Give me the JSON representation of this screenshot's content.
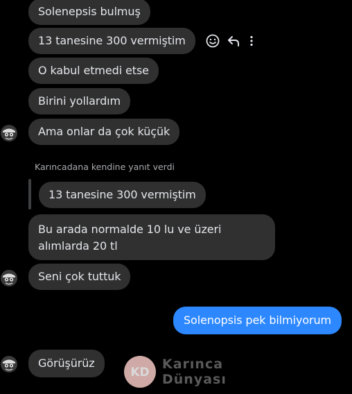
{
  "thread": {
    "messages": [
      {
        "text": "Solenepsis bulmuş"
      },
      {
        "text": "13 tanesine 300 vermiştim"
      },
      {
        "text": "O kabul etmedi etse"
      },
      {
        "text": "Birini yollardım"
      },
      {
        "text": "Ama onlar da çok küçük"
      },
      {
        "text": "Bu arada normalde 10 lu ve üzeri alımlarda 20 tl"
      },
      {
        "text": "Seni çok tuttuk"
      },
      {
        "text": "Solenopsis pek bilmiyorum"
      },
      {
        "text": "Görüşürüz"
      }
    ],
    "reply": {
      "note": "Karıncadana kendine yanıt verdi",
      "quoted": "13 tanesine 300 vermiştim"
    }
  },
  "message_actions": {
    "icons": [
      "emoji-react-icon",
      "reply-arrow-icon",
      "more-options-icon"
    ]
  },
  "watermark": {
    "logo": "KD",
    "line1": "Karınca",
    "line2": "Dünyası"
  },
  "colors": {
    "background": "#000000",
    "incoming_bubble": "#303030",
    "outgoing_bubble": "#2d88ff",
    "text": "#e4e6eb",
    "muted_text": "#a8abaf",
    "watermark_badge": "#f4c7c3"
  }
}
